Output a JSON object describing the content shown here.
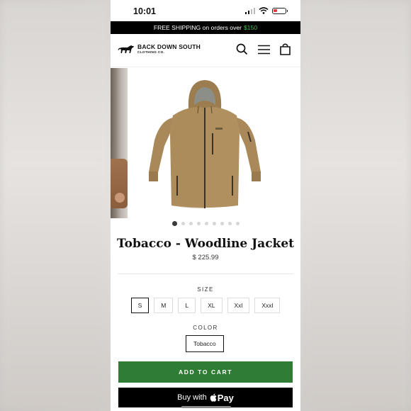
{
  "status_bar": {
    "time": "10:01"
  },
  "announcement": {
    "text": "FREE SHIPPING on orders over",
    "price": "$150"
  },
  "brand": {
    "name": "BACK DOWN SOUTH",
    "tagline": "CLOTHING CO."
  },
  "header": {
    "icons": [
      "search-icon",
      "menu-icon",
      "bag-icon"
    ]
  },
  "gallery": {
    "total_images": 9,
    "active_index": 0
  },
  "product": {
    "title": "Tobacco - Woodline Jacket",
    "price": "$ 225.99"
  },
  "size": {
    "label": "SIZE",
    "options": [
      "S",
      "M",
      "L",
      "XL",
      "Xxl",
      "Xxxl"
    ],
    "selected": "S"
  },
  "color": {
    "label": "COLOR",
    "selected": "Tobacco"
  },
  "actions": {
    "add_to_cart": "ADD TO CART",
    "buy_with": "Buy with",
    "pay": "Pay"
  },
  "colors": {
    "announcement_bg": "#000000",
    "price_accent": "#3fbf4f",
    "cart_button": "#2f7d34",
    "jacket": "#a9895a"
  }
}
